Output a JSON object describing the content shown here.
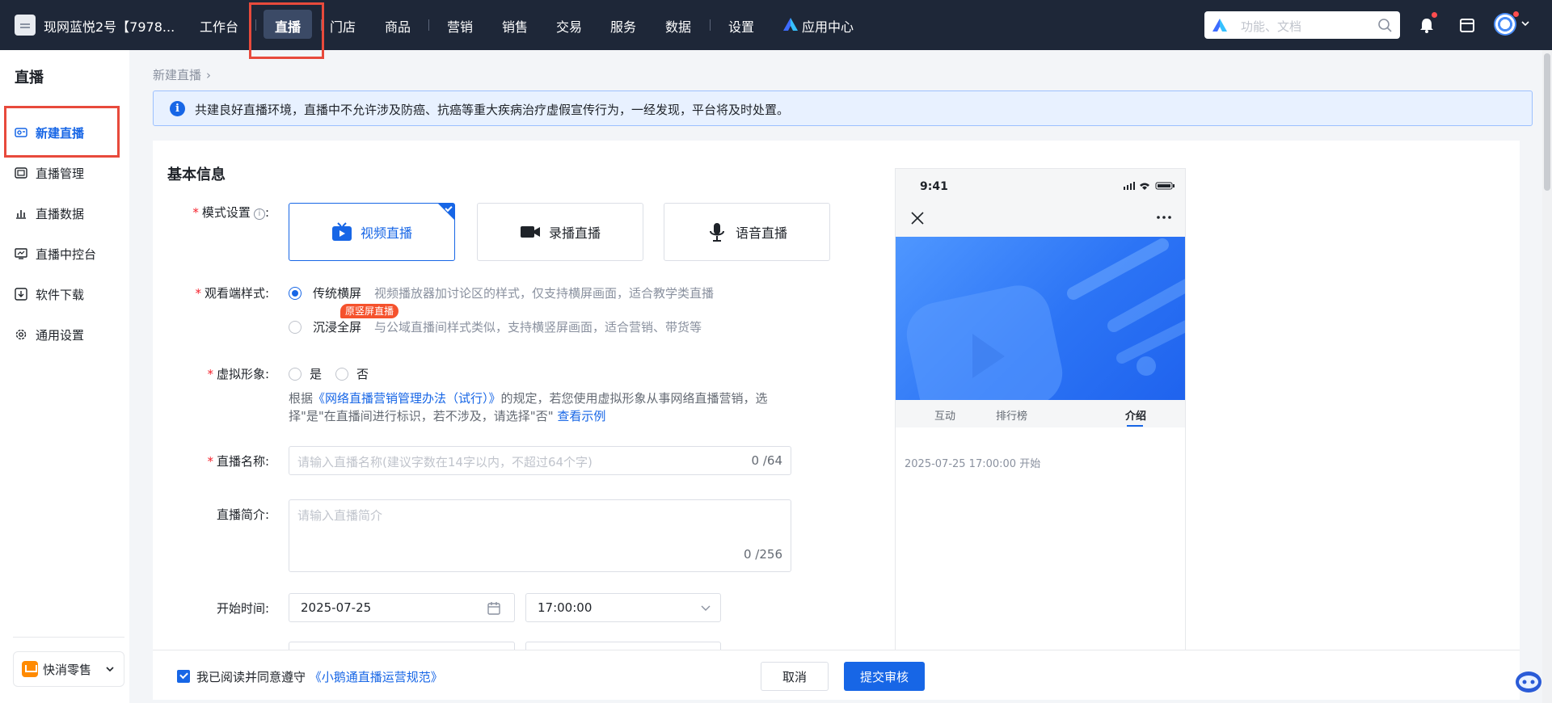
{
  "topbar": {
    "store_name": "现网蓝悦2号【7978...",
    "nav": [
      "工作台",
      "直播",
      "门店",
      "商品",
      "营销",
      "销售",
      "交易",
      "服务",
      "数据",
      "设置",
      "应用中心"
    ],
    "search_placeholder": "功能、文档"
  },
  "sidebar": {
    "title": "直播",
    "items": [
      {
        "label": "新建直播",
        "icon": "live-create-icon"
      },
      {
        "label": "直播管理",
        "icon": "live-manage-icon"
      },
      {
        "label": "直播数据",
        "icon": "chart-icon"
      },
      {
        "label": "直播中控台",
        "icon": "monitor-icon"
      },
      {
        "label": "软件下载",
        "icon": "download-icon"
      },
      {
        "label": "通用设置",
        "icon": "gear-icon"
      }
    ],
    "bottom_label": "快消零售"
  },
  "breadcrumb": "新建直播",
  "notice": "共建良好直播环境，直播中不允许涉及防癌、抗癌等重大疾病治疗虚假宣传行为，一经发现，平台将及时处置。",
  "form": {
    "section_title": "基本信息",
    "mode": {
      "label": "模式设置",
      "options": [
        "视频直播",
        "录播直播",
        "语音直播"
      ],
      "selected": "视频直播"
    },
    "view_style": {
      "label": "观看端样式:",
      "opt1": "传统横屏",
      "opt1_desc": "视频播放器加讨论区的样式，仅支持横屏画面，适合教学类直播",
      "opt2": "沉浸全屏",
      "opt2_desc": "与公域直播间样式类似，支持横竖屏画面，适合营销、带货等",
      "tag": "原竖屏直播"
    },
    "virtual": {
      "label": "虚拟形象:",
      "yes": "是",
      "no": "否",
      "desc_pre": "根据",
      "desc_link": "《网络直播营销管理办法（试行）》",
      "desc_mid": "的规定，若您使用虚拟形象从事网络直播营销，选择\"是\"在直播间进行标识，若不涉及，请选择\"否\"",
      "desc_link2": "查看示例"
    },
    "name": {
      "label": "直播名称:",
      "placeholder": "请输入直播名称(建议字数在14字以内，不超过64个字)",
      "counter": "0 /64"
    },
    "intro": {
      "label": "直播简介:",
      "placeholder": "请输入直播简介",
      "counter": "0 /256"
    },
    "start": {
      "label": "开始时间:",
      "date": "2025-07-25",
      "time": "17:00:00"
    }
  },
  "preview": {
    "time": "9:41",
    "tabs": [
      "互动",
      "排行榜",
      "介绍"
    ],
    "active_tab": "介绍",
    "start_text": "2025-07-25 17:00:00 开始"
  },
  "footer": {
    "agree_text": "我已阅读并同意遵守",
    "agree_link": "《小鹅通直播运营规范》",
    "cancel": "取消",
    "submit": "提交审核"
  },
  "colors": {
    "accent": "#1766e6",
    "topbar": "#1e2738",
    "highlight": "#e84a3c",
    "tag": "#f5522d"
  }
}
